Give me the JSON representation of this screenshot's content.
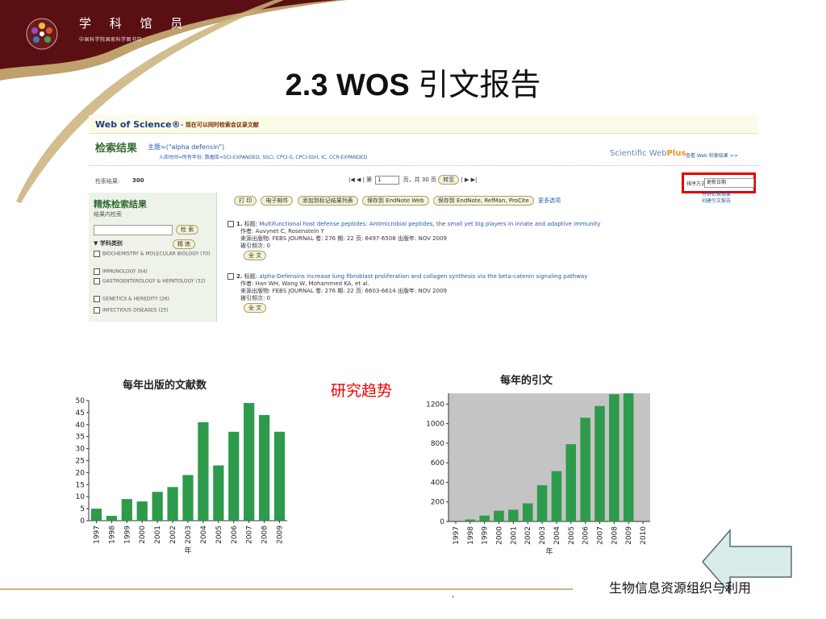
{
  "brand": {
    "title": "学 科 馆 员",
    "subtitle": "中国科学院国家科学图书馆"
  },
  "slide": {
    "title_latin": "2.3 WOS ",
    "title_cjk": "引文报告",
    "trend_label": "研究趋势",
    "footer": "生物信息资源组织与利用",
    "page_marker": "'"
  },
  "wos": {
    "brand": "Web of Science®",
    "brand_note": "– 现在可以同时检索会议录文献",
    "results_heading": "检索结果",
    "topic": "主题=(\"alpha defensin\")",
    "filters": "入库时间=所有年份. 数据库=SCI-EXPANDED, SSCI, CPCI-S, CPCI-SSH, IC, CCR-EXPANDED",
    "sciwebplus_a": "Scientific Web",
    "sciwebplus_b": "Plus",
    "web_results_link": "查看 Web 检索结果 >>",
    "count_label": "检索结果:",
    "count_value": "300",
    "pager_prefix": "|◀ ◀ | 第",
    "page_value": "1",
    "pager_suffix": "页，共 30 页",
    "go_button": "转至",
    "pager_next": "| ▶ ▶|",
    "sort_label": "排序方式:",
    "sort_value": "更新日期",
    "refine_title": "精炼检索结果",
    "refine_within": "结果内检索",
    "search_button": "检 索",
    "subject_heading": "▼  学科类别",
    "refine_button": "精 炼",
    "subjects": [
      "BIOCHEMISTRY & MOLECULAR BIOLOGY (70)",
      "IMMUNOLOGY (64)",
      "GASTROENTEROLOGY & HEPATOLOGY (32)",
      "GENETICS & HEREDITY (26)",
      "INFECTIOUS DISEASES (25)"
    ],
    "more_options": "更多选项",
    "toolbar": [
      "打 印",
      "电子邮件",
      "添加到标记结果列表",
      "保存到 EndNote Web",
      "保存到 EndNote, RefMan, ProCite"
    ],
    "analyze_link": "分析检索结果",
    "citation_report_link": "创建引文报告",
    "records": [
      {
        "num": "1.",
        "title_label": "标题:",
        "title": "Multifunctional host defense peptides: Antimicrobial peptides, the small yet big players in innate and adaptive immunity",
        "authors": "作者: Auvynet C, Rosenstein Y",
        "source": "来源出版物: FEBS JOURNAL  卷: 276  期: 22  页: 6497-6508  出版年: NOV 2009",
        "cited": "被引频次: 0",
        "fulltext": "全 文"
      },
      {
        "num": "2.",
        "title_label": "标题:",
        "title": "alpha-Defensins increase lung fibroblast proliferation and collagen synthesis via the beta-catenin signaling pathway",
        "authors": "作者: Han WH, Wang W, Mohammed KA, et al.",
        "source": "来源出版物: FEBS JOURNAL  卷: 276  期: 22  页: 6603-6614  出版年: NOV 2009",
        "cited": "被引频次: 0",
        "fulltext": "全 文"
      }
    ]
  },
  "colors": {
    "header_maroon": "#5a0f12",
    "header_gold": "#c9b27a",
    "bar_green": "#2e9a4c",
    "plot_gray": "#c4c4c4",
    "trend_red": "#ee0000",
    "sort_highlight": "#e00000",
    "arrow_fill": "#d8ecea"
  },
  "chart_data": [
    {
      "type": "bar",
      "title": "每年出版的文献数",
      "xlabel": "年",
      "ylabel": "",
      "categories": [
        "1997",
        "1998",
        "1999",
        "2000",
        "2001",
        "2002",
        "2003",
        "2004",
        "2005",
        "2006",
        "2007",
        "2008",
        "2009"
      ],
      "values": [
        5,
        2,
        9,
        8,
        12,
        14,
        19,
        41,
        23,
        37,
        49,
        44,
        37
      ],
      "ylim": [
        0,
        50
      ],
      "yticks": [
        0,
        5,
        10,
        15,
        20,
        25,
        30,
        35,
        40,
        45,
        50
      ],
      "grid": false
    },
    {
      "type": "bar",
      "title": "每年的引文",
      "xlabel": "年",
      "ylabel": "",
      "categories": [
        "1997",
        "1998",
        "1999",
        "2000",
        "2001",
        "2002",
        "2003",
        "2004",
        "2005",
        "2006",
        "2007",
        "2008",
        "2009",
        "2010"
      ],
      "values": [
        0,
        20,
        60,
        110,
        120,
        185,
        370,
        515,
        790,
        1060,
        1180,
        1300,
        1310,
        0
      ],
      "ylim": [
        0,
        1300
      ],
      "yticks": [
        0,
        200,
        400,
        600,
        800,
        1000,
        1200
      ],
      "grid": false
    }
  ]
}
